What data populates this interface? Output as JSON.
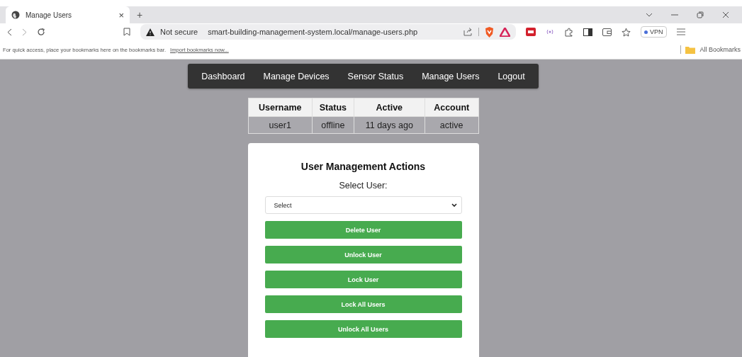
{
  "browser": {
    "tab": {
      "title": "Manage Users",
      "close": "×"
    },
    "new_tab": "+",
    "address": {
      "security": "Not secure",
      "url": "smart-building-management-system.local/manage-users.php"
    },
    "vpn": "VPN",
    "bookmarks_hint": "For quick access, place your bookmarks here on the bookmarks bar.",
    "import_link": "Import bookmarks now...",
    "all_bookmarks": "All Bookmarks"
  },
  "nav": [
    {
      "label": "Dashboard",
      "selected": false
    },
    {
      "label": "Manage Devices",
      "selected": false
    },
    {
      "label": "Sensor Status",
      "selected": false
    },
    {
      "label": "Manage Users",
      "selected": false
    },
    {
      "label": "Logout",
      "selected": false
    }
  ],
  "table": {
    "columns": [
      "Username",
      "Status",
      "Active",
      "Account"
    ],
    "rows": [
      [
        "user1",
        "offline",
        "11 days ago",
        "active"
      ]
    ]
  },
  "card": {
    "title": "User Management Actions",
    "select_label": "Select User:",
    "select": {
      "value": "Select"
    },
    "buttons": [
      "Delete User",
      "Unlock User",
      "Lock User",
      "Lock All Users",
      "Unlock All Users"
    ]
  }
}
